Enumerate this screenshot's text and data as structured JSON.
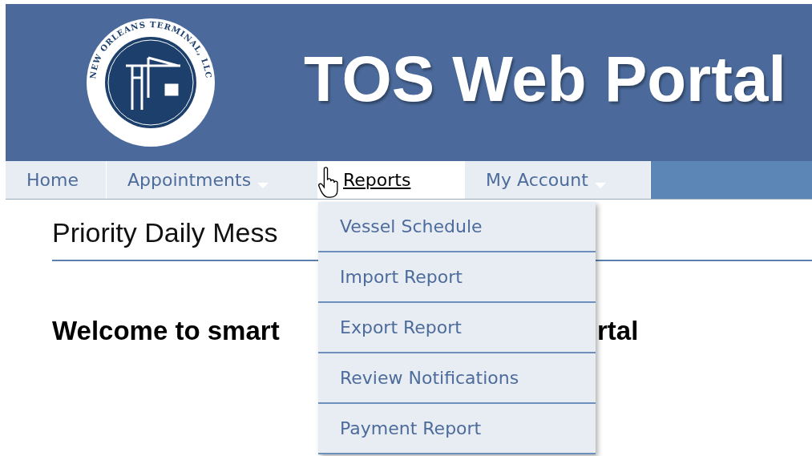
{
  "header": {
    "logo_text": "NEW ORLEANS TERMINAL, LLC",
    "title": "TOS Web Portal"
  },
  "nav": [
    {
      "label": "Home",
      "has_menu": false,
      "selected": false
    },
    {
      "label": "Appointments",
      "has_menu": true,
      "selected": false
    },
    {
      "label": "Reports",
      "has_menu": false,
      "selected": true
    },
    {
      "label": "My Account",
      "has_menu": true,
      "selected": false
    }
  ],
  "dropdown": {
    "items": [
      "Vessel Schedule",
      "Import Report",
      "Export Report",
      "Review Notifications",
      "Payment Report"
    ]
  },
  "content": {
    "section_title": "Priority Daily Mess",
    "welcome_parts": [
      "Welcome to smart",
      "rtal"
    ]
  }
}
